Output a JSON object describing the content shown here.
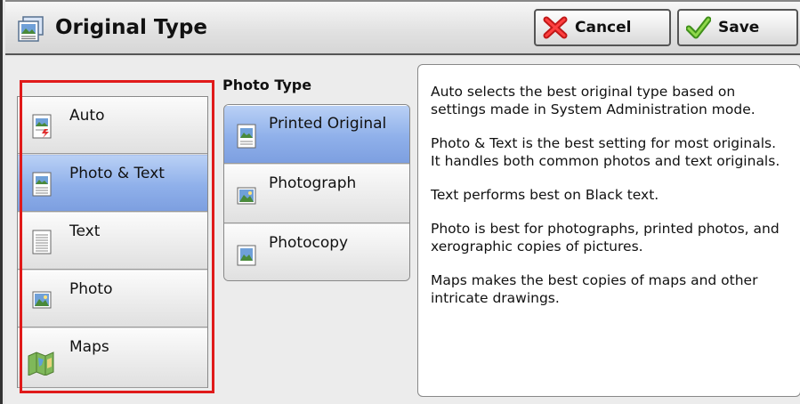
{
  "title": "Original Type",
  "buttons": {
    "cancel": "Cancel",
    "save": "Save"
  },
  "original_types": [
    {
      "label": "Auto",
      "icon": "auto-icon",
      "selected": false
    },
    {
      "label": "Photo & Text",
      "icon": "photo-text-icon",
      "selected": true
    },
    {
      "label": "Text",
      "icon": "text-icon",
      "selected": false
    },
    {
      "label": "Photo",
      "icon": "photo-icon",
      "selected": false
    },
    {
      "label": "Maps",
      "icon": "maps-icon",
      "selected": false
    }
  ],
  "photo_type": {
    "heading": "Photo Type",
    "options": [
      {
        "label": "Printed Original",
        "selected": true
      },
      {
        "label": "Photograph",
        "selected": false
      },
      {
        "label": "Photocopy",
        "selected": false
      }
    ]
  },
  "description": [
    "Auto selects the best original type based on settings made in System Administration mode.",
    "Photo & Text is the best setting for most originals. It handles both common photos and text originals.",
    "Text performs best on Black text.",
    "Photo is best for photographs, printed photos, and xerographic copies of pictures.",
    "Maps makes the best copies of maps and other intricate drawings."
  ],
  "colors": {
    "selected": "#8fb0ea",
    "highlight_frame": "#e01a1a"
  }
}
